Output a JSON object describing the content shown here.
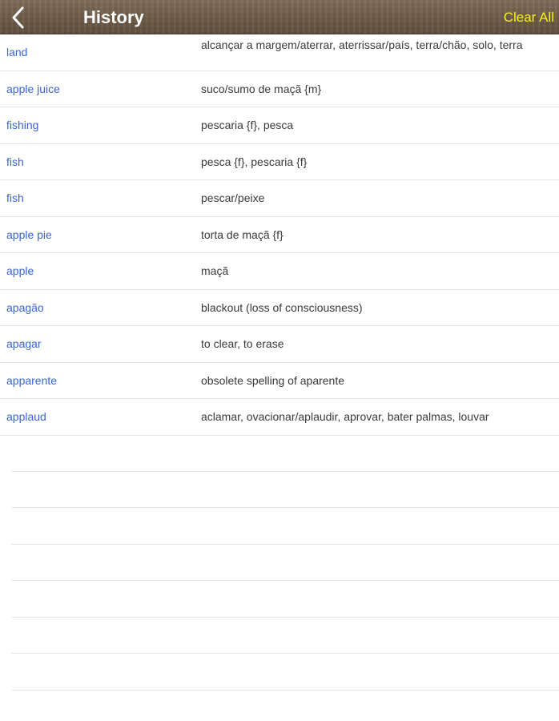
{
  "navbar": {
    "title": "History",
    "clear_all_label": "Clear All",
    "back_icon": "chevron-left-icon",
    "clear_all_color": "#f5f01a"
  },
  "history": [
    {
      "term": "land",
      "definition": "alcançar a margem/aterrar, aterrissar/país, terra/chão, solo, terra"
    },
    {
      "term": "apple juice",
      "definition": "suco/sumo de maçã {m}"
    },
    {
      "term": "fishing",
      "definition": "pescaria {f}, pesca"
    },
    {
      "term": "fish",
      "definition": "pesca {f}, pescaria {f}"
    },
    {
      "term": "fish",
      "definition": "pescar/peixe"
    },
    {
      "term": "apple pie",
      "definition": "torta de maçã {f}"
    },
    {
      "term": "apple",
      "definition": "maçã"
    },
    {
      "term": "apagão",
      "definition": "blackout (loss of consciousness)"
    },
    {
      "term": "apagar",
      "definition": "to clear, to erase"
    },
    {
      "term": "apparente",
      "definition": "obsolete spelling of aparente"
    },
    {
      "term": "applaud",
      "definition": "aclamar, ovacionar/aplaudir, aprovar, bater palmas, louvar"
    }
  ],
  "colors": {
    "term": "#3b64d8",
    "definition": "#3a3a3a",
    "separator": "#e6e6e6"
  }
}
